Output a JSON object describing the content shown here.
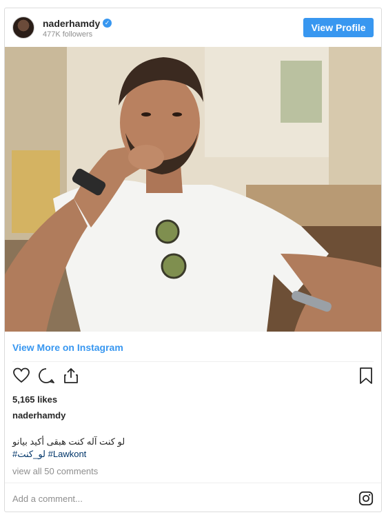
{
  "header": {
    "username": "naderhamdy",
    "verified": "✓",
    "followers": "477K followers",
    "view_profile_label": "View Profile"
  },
  "post": {
    "image_icon": "photo",
    "view_more_label": "View More on Instagram",
    "likes": "5,165 likes",
    "owner": "naderhamdy",
    "caption": "لو كنت آله كنت هبقى أكيد بيانو",
    "hashtags": "#لو_كنت #Lawkont",
    "view_comments": "view all 50 comments",
    "add_comment_placeholder": "Add a comment..."
  },
  "icons": {
    "like": "heart-icon",
    "comment": "comment-icon",
    "share": "share-icon",
    "save": "bookmark-icon",
    "instagram": "instagram-icon"
  },
  "colors": {
    "accent": "#3897f0",
    "hashtag": "#003569",
    "muted": "#8e8e8e"
  }
}
